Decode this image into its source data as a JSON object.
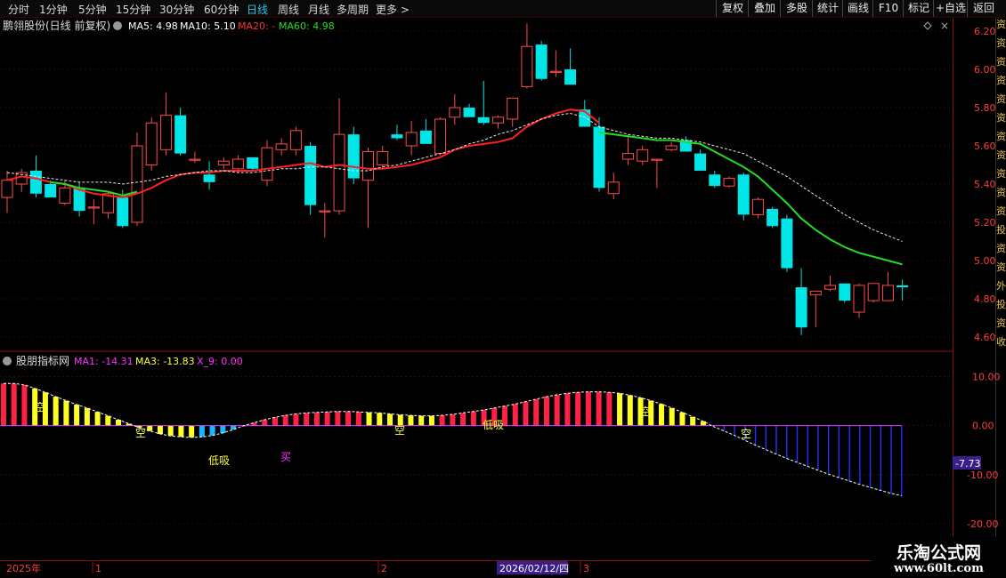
{
  "toolbar": {
    "periods": [
      "分时",
      "1分钟",
      "5分钟",
      "15分钟",
      "30分钟",
      "60分钟",
      "日线",
      "周线",
      "月线",
      "多周期",
      "更多 >"
    ],
    "active_period": "日线",
    "buttons": [
      "复权",
      "叠加",
      "多股",
      "统计",
      "画线",
      "F10",
      "标记",
      "+自选",
      "返回"
    ]
  },
  "main_header": {
    "stock_label": "鹏翎股份(日线 前复权)",
    "ma5": "MA5: 4.98",
    "ma10": "MA10: 5.10",
    "ma20": "MA20: -",
    "ma60": "MA60: 4.98"
  },
  "indicator_header": {
    "name": "股朋指标网",
    "ma1": "MA1: -14.31",
    "ma3": "MA3: -13.83",
    "x9": "X_9: 0.00"
  },
  "price_axis_labels": [
    "6.20",
    "6.00",
    "5.80",
    "5.60",
    "5.40",
    "5.20",
    "5.00",
    "4.80",
    "4.60"
  ],
  "indicator_axis_labels": [
    "10.00",
    "0.00",
    "-10.00",
    "-20.00"
  ],
  "indicator_value_tag": "-7.73",
  "bottom_axis": {
    "year": "2025年",
    "marks": [
      "1",
      "2",
      "3"
    ],
    "cursor_date": "2026/02/12/四"
  },
  "signal_labels": [
    "空",
    "空",
    "低吸",
    "买",
    "空",
    "低吸",
    "空",
    "空"
  ],
  "side_strip_text": "资资资资资资资资资资资投资资外投资收",
  "ad": {
    "line1": "乐淘公式网",
    "line2": "www.60lt.com"
  },
  "colors": {
    "up": "#ff4b4b",
    "down": "#00e5e5",
    "ma_red": "#ff2020",
    "ma_green": "#22dd22",
    "ma_white": "#e8e8e8",
    "hist_yellow": "#ffff22",
    "hist_red": "#ff2244",
    "hist_blue": "#2233ff",
    "hist_cyan": "#19b7ff",
    "axis_red": "#8b1010"
  },
  "chart_data": [
    {
      "type": "candlestick",
      "title": "鹏翎股份(日线 前复权)",
      "ylim": [
        4.53,
        6.27
      ],
      "y_ticks": [
        4.6,
        4.8,
        5.0,
        5.2,
        5.4,
        5.6,
        5.8,
        6.0,
        6.2
      ],
      "candles": [
        {
          "o": 5.33,
          "h": 5.47,
          "l": 5.25,
          "c": 5.42
        },
        {
          "o": 5.4,
          "h": 5.48,
          "l": 5.36,
          "c": 5.46
        },
        {
          "o": 5.47,
          "h": 5.55,
          "l": 5.33,
          "c": 5.35
        },
        {
          "o": 5.4,
          "h": 5.42,
          "l": 5.33,
          "c": 5.33
        },
        {
          "o": 5.3,
          "h": 5.42,
          "l": 5.29,
          "c": 5.38
        },
        {
          "o": 5.38,
          "h": 5.41,
          "l": 5.23,
          "c": 5.26
        },
        {
          "o": 5.28,
          "h": 5.32,
          "l": 5.19,
          "c": 5.28
        },
        {
          "o": 5.25,
          "h": 5.36,
          "l": 5.22,
          "c": 5.35
        },
        {
          "o": 5.33,
          "h": 5.37,
          "l": 5.17,
          "c": 5.18
        },
        {
          "o": 5.2,
          "h": 5.67,
          "l": 5.18,
          "c": 5.6
        },
        {
          "o": 5.5,
          "h": 5.75,
          "l": 5.47,
          "c": 5.72
        },
        {
          "o": 5.58,
          "h": 5.88,
          "l": 5.55,
          "c": 5.76
        },
        {
          "o": 5.76,
          "h": 5.8,
          "l": 5.55,
          "c": 5.56
        },
        {
          "o": 5.53,
          "h": 5.57,
          "l": 5.51,
          "c": 5.53
        },
        {
          "o": 5.45,
          "h": 5.52,
          "l": 5.37,
          "c": 5.41
        },
        {
          "o": 5.5,
          "h": 5.54,
          "l": 5.48,
          "c": 5.52
        },
        {
          "o": 5.48,
          "h": 5.55,
          "l": 5.46,
          "c": 5.53
        },
        {
          "o": 5.54,
          "h": 5.54,
          "l": 5.47,
          "c": 5.48
        },
        {
          "o": 5.42,
          "h": 5.63,
          "l": 5.39,
          "c": 5.59
        },
        {
          "o": 5.58,
          "h": 5.64,
          "l": 5.55,
          "c": 5.61
        },
        {
          "o": 5.58,
          "h": 5.7,
          "l": 5.55,
          "c": 5.68
        },
        {
          "o": 5.6,
          "h": 5.62,
          "l": 5.24,
          "c": 5.29
        },
        {
          "o": 5.26,
          "h": 5.3,
          "l": 5.12,
          "c": 5.26
        },
        {
          "o": 5.26,
          "h": 5.85,
          "l": 5.24,
          "c": 5.66
        },
        {
          "o": 5.66,
          "h": 5.7,
          "l": 5.4,
          "c": 5.43
        },
        {
          "o": 5.42,
          "h": 5.59,
          "l": 5.17,
          "c": 5.57
        },
        {
          "o": 5.5,
          "h": 5.6,
          "l": 5.48,
          "c": 5.57
        },
        {
          "o": 5.66,
          "h": 5.71,
          "l": 5.63,
          "c": 5.64
        },
        {
          "o": 5.6,
          "h": 5.73,
          "l": 5.55,
          "c": 5.67
        },
        {
          "o": 5.68,
          "h": 5.74,
          "l": 5.62,
          "c": 5.61
        },
        {
          "o": 5.56,
          "h": 5.75,
          "l": 5.55,
          "c": 5.74
        },
        {
          "o": 5.75,
          "h": 5.87,
          "l": 5.71,
          "c": 5.8
        },
        {
          "o": 5.8,
          "h": 5.82,
          "l": 5.76,
          "c": 5.75
        },
        {
          "o": 5.75,
          "h": 5.94,
          "l": 5.71,
          "c": 5.72
        },
        {
          "o": 5.72,
          "h": 5.76,
          "l": 5.69,
          "c": 5.75
        },
        {
          "o": 5.74,
          "h": 5.85,
          "l": 5.7,
          "c": 5.85
        },
        {
          "o": 5.91,
          "h": 6.24,
          "l": 5.9,
          "c": 6.12
        },
        {
          "o": 6.13,
          "h": 6.15,
          "l": 5.94,
          "c": 5.95
        },
        {
          "o": 5.99,
          "h": 6.1,
          "l": 5.96,
          "c": 5.99
        },
        {
          "o": 6.0,
          "h": 6.11,
          "l": 5.92,
          "c": 5.92
        },
        {
          "o": 5.79,
          "h": 5.84,
          "l": 5.74,
          "c": 5.7
        },
        {
          "o": 5.7,
          "h": 5.75,
          "l": 5.36,
          "c": 5.38
        },
        {
          "o": 5.35,
          "h": 5.46,
          "l": 5.32,
          "c": 5.41
        },
        {
          "o": 5.53,
          "h": 5.66,
          "l": 5.5,
          "c": 5.56
        },
        {
          "o": 5.52,
          "h": 5.6,
          "l": 5.5,
          "c": 5.58
        },
        {
          "o": 5.53,
          "h": 5.53,
          "l": 5.38,
          "c": 5.53
        },
        {
          "o": 5.58,
          "h": 5.62,
          "l": 5.57,
          "c": 5.6
        },
        {
          "o": 5.63,
          "h": 5.65,
          "l": 5.57,
          "c": 5.57
        },
        {
          "o": 5.56,
          "h": 5.58,
          "l": 5.47,
          "c": 5.47
        },
        {
          "o": 5.45,
          "h": 5.47,
          "l": 5.38,
          "c": 5.39
        },
        {
          "o": 5.39,
          "h": 5.44,
          "l": 5.38,
          "c": 5.43
        },
        {
          "o": 5.45,
          "h": 5.46,
          "l": 5.21,
          "c": 5.24
        },
        {
          "o": 5.24,
          "h": 5.33,
          "l": 5.22,
          "c": 5.32
        },
        {
          "o": 5.27,
          "h": 5.28,
          "l": 5.17,
          "c": 5.18
        },
        {
          "o": 5.22,
          "h": 5.24,
          "l": 4.94,
          "c": 4.96
        },
        {
          "o": 4.86,
          "h": 4.96,
          "l": 4.61,
          "c": 4.65
        },
        {
          "o": 4.82,
          "h": 4.84,
          "l": 4.65,
          "c": 4.84
        },
        {
          "o": 4.85,
          "h": 4.92,
          "l": 4.84,
          "c": 4.87
        },
        {
          "o": 4.88,
          "h": 4.88,
          "l": 4.78,
          "c": 4.79
        },
        {
          "o": 4.73,
          "h": 4.88,
          "l": 4.7,
          "c": 4.87
        },
        {
          "o": 4.79,
          "h": 4.88,
          "l": 4.78,
          "c": 4.88
        },
        {
          "o": 4.79,
          "h": 4.94,
          "l": 4.79,
          "c": 4.87
        },
        {
          "o": 4.87,
          "h": 4.9,
          "l": 4.79,
          "c": 4.86
        }
      ],
      "series": [
        {
          "name": "MA20",
          "color": "red",
          "start": 0,
          "values": [
            5.42,
            5.44,
            5.43,
            5.41,
            5.4,
            5.37,
            5.35,
            5.34,
            5.33,
            5.35,
            5.38,
            5.42,
            5.45,
            5.46,
            5.46,
            5.47,
            5.47,
            5.47,
            5.48,
            5.49,
            5.5,
            5.51,
            5.49,
            5.5,
            5.49,
            5.48,
            5.48,
            5.49,
            5.5,
            5.52,
            5.54,
            5.58,
            5.6,
            5.61,
            5.62,
            5.64,
            5.7,
            5.74,
            5.77,
            5.79,
            5.78,
            5.72
          ]
        },
        {
          "name": "MA60",
          "color": "green",
          "start": 3,
          "values": [
            5.41,
            5.4,
            5.38,
            5.37,
            5.36,
            5.34,
            5.36
          ]
        },
        {
          "name": "MA60",
          "color": "green",
          "start": 41,
          "values": [
            5.67,
            5.66,
            5.65,
            5.64,
            5.63,
            5.63,
            5.62,
            5.61,
            5.57,
            5.53,
            5.49,
            5.44,
            5.37,
            5.3,
            5.22,
            5.16,
            5.11,
            5.07,
            5.04,
            5.02,
            5.0,
            4.98
          ]
        },
        {
          "name": "",
          "color": "white-dashed",
          "start": 0,
          "values": [
            5.46,
            5.45,
            5.44,
            5.43,
            5.42,
            5.41,
            5.41,
            5.41,
            5.4,
            5.41,
            5.42,
            5.44,
            5.45,
            5.46,
            5.47,
            5.47,
            5.46,
            5.46,
            5.47,
            5.48,
            5.48,
            5.49,
            5.49,
            5.48,
            5.47,
            5.47,
            5.49,
            5.5,
            5.52,
            5.54,
            5.56,
            5.58,
            5.61,
            5.63,
            5.66,
            5.68,
            5.71,
            5.74,
            5.76,
            5.77,
            5.75,
            5.7,
            5.68,
            5.66,
            5.65,
            5.64,
            5.64,
            5.63,
            5.62,
            5.6,
            5.58,
            5.56,
            5.52,
            5.48,
            5.44,
            5.39,
            5.34,
            5.29,
            5.24,
            5.2,
            5.16,
            5.13,
            5.1
          ]
        }
      ]
    },
    {
      "type": "bar",
      "title": "股朋指标网",
      "ylim": [
        -22,
        11
      ],
      "y_ticks": [
        10,
        0,
        -10,
        -20
      ],
      "values": [
        8.6,
        8.6,
        8.3,
        7.6,
        6.8,
        5.9,
        5.1,
        4.3,
        3.6,
        2.8,
        2.0,
        1.2,
        0.4,
        -0.4,
        -1.1,
        -1.7,
        -2.1,
        -2.3,
        -2.4,
        -2.3,
        -2.0,
        -1.5,
        -0.8,
        0.0,
        0.6,
        1.2,
        1.7,
        2.1,
        2.4,
        2.6,
        2.7,
        2.8,
        2.9,
        2.9,
        2.8,
        2.7,
        2.6,
        2.4,
        2.2,
        2.1,
        2.0,
        2.0,
        2.1,
        2.3,
        2.6,
        2.9,
        3.2,
        3.6,
        4.0,
        4.4,
        4.9,
        5.4,
        5.9,
        6.3,
        6.6,
        6.8,
        6.9,
        6.9,
        6.8,
        6.6,
        6.2,
        5.7,
        5.1,
        4.4,
        3.6,
        2.7,
        1.8,
        0.9,
        -0.2,
        -1.1,
        -2.0,
        -3.0,
        -4.0,
        -4.9,
        -5.8,
        -6.7,
        -7.5,
        -8.3,
        -9.1,
        -9.9,
        -10.6,
        -11.3,
        -12.0,
        -12.6,
        -13.2,
        -13.8,
        -14.3
      ],
      "bar_colors": [
        "red",
        "red",
        "red",
        "yellow",
        "yellow",
        "yellow",
        "yellow",
        "yellow",
        "yellow",
        "yellow",
        "yellow",
        "yellow",
        "yellow",
        "yellow",
        "yellow",
        "yellow",
        "yellow",
        "yellow",
        "yellow",
        "cyan",
        "cyan",
        "cyan",
        "cyan",
        "red",
        "red",
        "red",
        "red",
        "red",
        "red",
        "red",
        "red",
        "red",
        "red",
        "red",
        "red",
        "yellow",
        "yellow",
        "yellow",
        "yellow",
        "yellow",
        "yellow",
        "yellow",
        "red",
        "red",
        "red",
        "red",
        "red",
        "red",
        "red",
        "red",
        "red",
        "red",
        "red",
        "red",
        "red",
        "red",
        "red",
        "red",
        "red",
        "yellow",
        "yellow",
        "yellow",
        "yellow",
        "yellow",
        "yellow",
        "yellow",
        "yellow",
        "yellow",
        "blue",
        "blue",
        "blue",
        "blue",
        "blue",
        "blue",
        "blue",
        "blue",
        "blue",
        "blue",
        "blue",
        "blue",
        "blue",
        "blue",
        "blue",
        "blue",
        "blue",
        "blue",
        "blue"
      ],
      "x_labels": [
        "2025年",
        "1",
        "2",
        "2026/02/12/四",
        "3"
      ]
    }
  ]
}
